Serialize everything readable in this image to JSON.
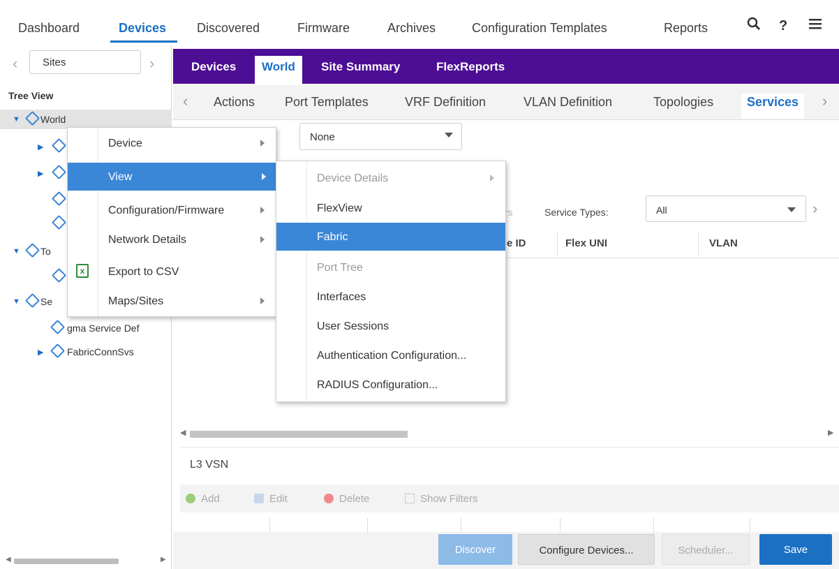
{
  "topnav": {
    "tabs": [
      "Dashboard",
      "Devices",
      "Discovered",
      "Firmware",
      "Archives",
      "Configuration Templates",
      "Reports"
    ],
    "active": "Devices",
    "icons": [
      "search-icon",
      "help-icon",
      "menu-icon"
    ],
    "help_glyph": "?"
  },
  "left": {
    "sites_label": "Sites",
    "tree_view_label": "Tree View",
    "tree": [
      {
        "label": "World"
      },
      {
        "label": ""
      },
      {
        "label": ""
      },
      {
        "label": ""
      },
      {
        "label": ""
      },
      {
        "label": "To"
      },
      {
        "label": ""
      },
      {
        "label": "Se"
      },
      {
        "label": "gma Service Def"
      },
      {
        "label": "FabricConnSvs"
      }
    ]
  },
  "purplebar": {
    "tabs": [
      "Devices",
      "World",
      "Site Summary",
      "FlexReports"
    ],
    "active": "World"
  },
  "subtabs": {
    "tabs": [
      "Actions",
      "Port Templates",
      "VRF Definition",
      "VLAN Definition",
      "Topologies",
      "Services"
    ],
    "active": "Services"
  },
  "dropdown_none": {
    "value": "None"
  },
  "services": {
    "filters_partial": "lters",
    "service_types_label": "Service Types:",
    "service_types_value": "All"
  },
  "table_head": {
    "cols": [
      "e ID",
      "Flex UNI",
      "VLAN"
    ]
  },
  "l3vsn": {
    "title": "L3 VSN",
    "toolbar": {
      "add": "Add",
      "edit": "Edit",
      "delete": "Delete",
      "show_filters": "Show Filters"
    }
  },
  "footer": {
    "discover": "Discover",
    "configure": "Configure Devices...",
    "scheduler": "Scheduler...",
    "save": "Save"
  },
  "context_menu": {
    "items": [
      {
        "label": "Device",
        "submenu": true
      },
      {
        "label": "View",
        "submenu": true,
        "highlighted": true
      },
      {
        "label": "Configuration/Firmware",
        "submenu": true
      },
      {
        "label": "Network Details",
        "submenu": true
      },
      {
        "label": "Export to CSV",
        "submenu": false,
        "icon": "csv-icon"
      },
      {
        "label": "Maps/Sites",
        "submenu": true
      }
    ]
  },
  "view_submenu": {
    "items": [
      {
        "label": "Device Details",
        "disabled": true,
        "submenu": true
      },
      {
        "label": "FlexView"
      },
      {
        "label": "Fabric",
        "highlighted": true
      },
      {
        "label": "Port Tree",
        "disabled": true
      },
      {
        "label": "Interfaces"
      },
      {
        "label": "User Sessions"
      },
      {
        "label": "Authentication Configuration..."
      },
      {
        "label": "RADIUS Configuration..."
      }
    ]
  },
  "colors": {
    "accent": "#1b70c4",
    "purple_bar": "#4c0e94",
    "menu_highlight": "#3b87d7"
  }
}
